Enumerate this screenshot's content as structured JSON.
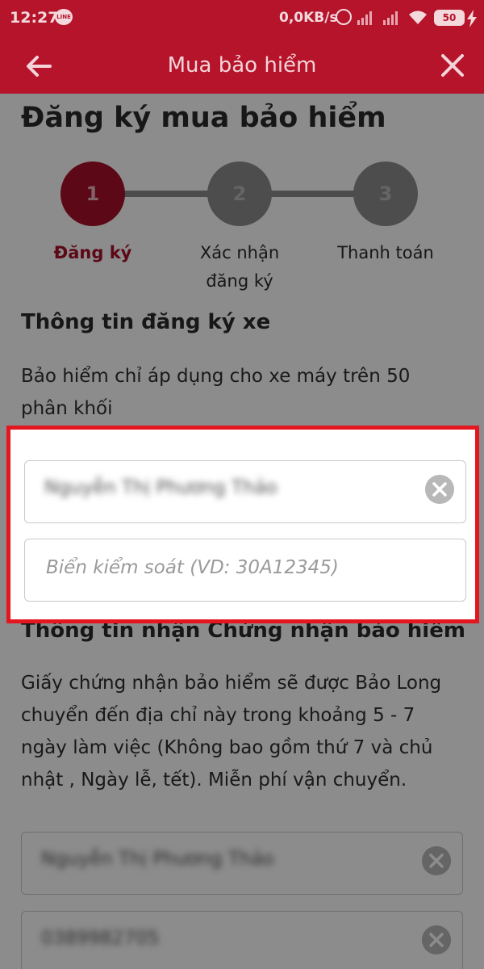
{
  "status_bar": {
    "time": "12:27",
    "line_app": "LINE",
    "network_speed": "0,0KB/s",
    "battery": "50",
    "icons": [
      "line-icon",
      "alarm-icon",
      "signal-icon",
      "signal-icon",
      "wifi-icon",
      "battery-icon",
      "bolt-icon"
    ]
  },
  "header": {
    "title": "Mua bảo hiểm",
    "back_icon": "arrow-left-icon",
    "close_icon": "close-icon"
  },
  "page": {
    "title": "Đăng ký mua bảo hiểm"
  },
  "stepper": {
    "steps": [
      {
        "number": "1",
        "label_line1": "Đăng ký",
        "label_line2": "",
        "active": true
      },
      {
        "number": "2",
        "label_line1": "Xác nhận",
        "label_line2": "đăng ký",
        "active": false
      },
      {
        "number": "3",
        "label_line1": "Thanh toán",
        "label_line2": "",
        "active": false
      }
    ]
  },
  "vehicle_section": {
    "title": "Thông tin đăng ký xe",
    "note_line1": "Bảo hiểm chỉ áp dụng cho xe máy trên 50",
    "note_line2": "phân khối",
    "owner_name_value": "Nguyễn Thị Phương Thảo",
    "plate_placeholder": "Biển kiểm soát (VD: 30A12345)"
  },
  "certificate_section": {
    "title": "Thông tin nhận Chứng nhận bảo hiểm",
    "description_lines": [
      "Giấy chứng nhận bảo hiểm sẽ được Bảo Long",
      "chuyển đến địa chỉ này trong khoảng 5 - 7",
      "ngày làm việc (Không bao gồm thứ 7 và chủ",
      "nhật , Ngày lễ, tết). Miễn phí vận chuyển."
    ],
    "recipient_name_value": "Nguyễn Thị Phương Thảo",
    "phone_value": "0389982705"
  },
  "colors": {
    "brand": "#b5142b",
    "active_step": "#a8102a",
    "highlight_border": "#e4161f"
  }
}
